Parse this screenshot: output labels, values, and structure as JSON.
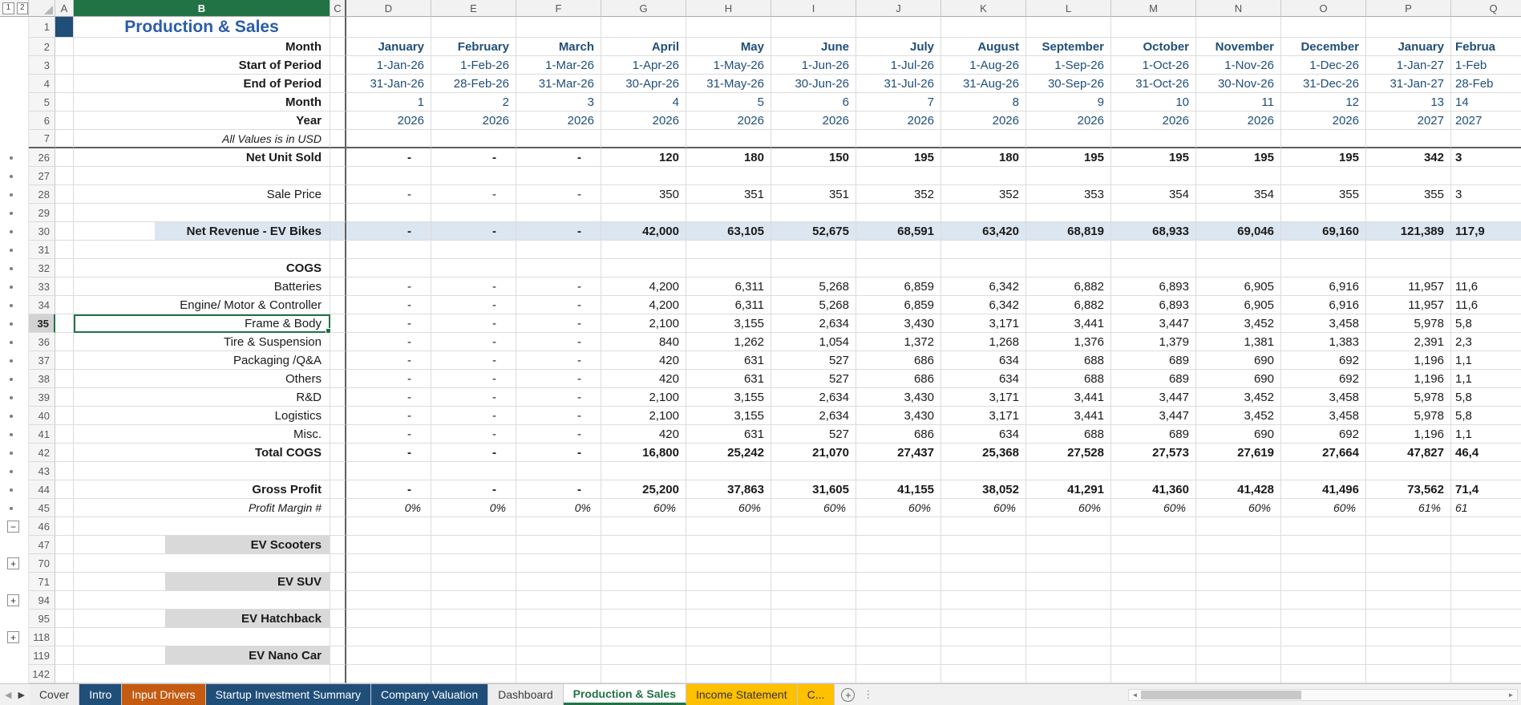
{
  "sheet": {
    "name": "Production & Sales",
    "outline_levels": [
      "1",
      "2"
    ],
    "outline_marks": {
      "collapse": "−",
      "expand": "+"
    },
    "columns": [
      "A",
      "B",
      "C",
      "D",
      "E",
      "F",
      "G",
      "H",
      "I",
      "J",
      "K",
      "L",
      "M",
      "N",
      "O",
      "P",
      "Q"
    ],
    "selection": {
      "cell": "B35",
      "column": "B",
      "row": 35
    },
    "rows": [
      {
        "n": 1,
        "type": "title",
        "label": "Production & Sales"
      },
      {
        "n": 2,
        "type": "months",
        "label": "Month",
        "values": [
          "January",
          "February",
          "March",
          "April",
          "May",
          "June",
          "July",
          "August",
          "September",
          "October",
          "November",
          "December",
          "January",
          "Februa"
        ]
      },
      {
        "n": 3,
        "type": "hdr",
        "label": "Start of Period",
        "values": [
          "1-Jan-26",
          "1-Feb-26",
          "1-Mar-26",
          "1-Apr-26",
          "1-May-26",
          "1-Jun-26",
          "1-Jul-26",
          "1-Aug-26",
          "1-Sep-26",
          "1-Oct-26",
          "1-Nov-26",
          "1-Dec-26",
          "1-Jan-27",
          "1-Feb"
        ]
      },
      {
        "n": 4,
        "type": "hdr",
        "label": "End of Period",
        "values": [
          "31-Jan-26",
          "28-Feb-26",
          "31-Mar-26",
          "30-Apr-26",
          "31-May-26",
          "30-Jun-26",
          "31-Jul-26",
          "31-Aug-26",
          "30-Sep-26",
          "31-Oct-26",
          "30-Nov-26",
          "31-Dec-26",
          "31-Jan-27",
          "28-Feb"
        ]
      },
      {
        "n": 5,
        "type": "hdr",
        "label": "Month",
        "values": [
          "1",
          "2",
          "3",
          "4",
          "5",
          "6",
          "7",
          "8",
          "9",
          "10",
          "11",
          "12",
          "13",
          "14"
        ]
      },
      {
        "n": 6,
        "type": "hdr",
        "label": "Year",
        "values": [
          "2026",
          "2026",
          "2026",
          "2026",
          "2026",
          "2026",
          "2026",
          "2026",
          "2026",
          "2026",
          "2026",
          "2026",
          "2027",
          "2027"
        ]
      },
      {
        "n": 7,
        "type": "note",
        "label": "All Values is in USD",
        "divider": true
      },
      {
        "n": 26,
        "type": "bold",
        "gutter": "dot",
        "label": "Net Unit Sold",
        "values": [
          "-",
          "-",
          "-",
          "120",
          "180",
          "150",
          "195",
          "180",
          "195",
          "195",
          "195",
          "195",
          "342",
          "3"
        ]
      },
      {
        "n": 27,
        "type": "blank",
        "gutter": "dot"
      },
      {
        "n": 28,
        "type": "plain",
        "gutter": "dot",
        "label": "Sale Price",
        "values": [
          "-",
          "-",
          "-",
          "350",
          "351",
          "351",
          "352",
          "352",
          "353",
          "354",
          "354",
          "355",
          "355",
          "3"
        ]
      },
      {
        "n": 29,
        "type": "blank",
        "gutter": "dot"
      },
      {
        "n": 30,
        "type": "highlight",
        "gutter": "dot",
        "label": "Net Revenue - EV Bikes",
        "values": [
          "-",
          "-",
          "-",
          "42,000",
          "63,105",
          "52,675",
          "68,591",
          "63,420",
          "68,819",
          "68,933",
          "69,046",
          "69,160",
          "121,389",
          "117,9"
        ]
      },
      {
        "n": 31,
        "type": "blank",
        "gutter": "dot"
      },
      {
        "n": 32,
        "type": "labelbold",
        "gutter": "dot",
        "label": "COGS"
      },
      {
        "n": 33,
        "type": "plain",
        "gutter": "dot",
        "label": "Batteries",
        "values": [
          "-",
          "-",
          "-",
          "4,200",
          "6,311",
          "5,268",
          "6,859",
          "6,342",
          "6,882",
          "6,893",
          "6,905",
          "6,916",
          "11,957",
          "11,6"
        ]
      },
      {
        "n": 34,
        "type": "plain",
        "gutter": "dot",
        "label": "Engine/ Motor & Controller",
        "values": [
          "-",
          "-",
          "-",
          "4,200",
          "6,311",
          "5,268",
          "6,859",
          "6,342",
          "6,882",
          "6,893",
          "6,905",
          "6,916",
          "11,957",
          "11,6"
        ]
      },
      {
        "n": 35,
        "type": "plain",
        "gutter": "dot",
        "label": "Frame & Body",
        "selected": true,
        "values": [
          "-",
          "-",
          "-",
          "2,100",
          "3,155",
          "2,634",
          "3,430",
          "3,171",
          "3,441",
          "3,447",
          "3,452",
          "3,458",
          "5,978",
          "5,8"
        ]
      },
      {
        "n": 36,
        "type": "plain",
        "gutter": "dot",
        "label": "Tire & Suspension",
        "values": [
          "-",
          "-",
          "-",
          "840",
          "1,262",
          "1,054",
          "1,372",
          "1,268",
          "1,376",
          "1,379",
          "1,381",
          "1,383",
          "2,391",
          "2,3"
        ]
      },
      {
        "n": 37,
        "type": "plain",
        "gutter": "dot",
        "label": "Packaging /Q&A",
        "values": [
          "-",
          "-",
          "-",
          "420",
          "631",
          "527",
          "686",
          "634",
          "688",
          "689",
          "690",
          "692",
          "1,196",
          "1,1"
        ]
      },
      {
        "n": 38,
        "type": "plain",
        "gutter": "dot",
        "label": "Others",
        "values": [
          "-",
          "-",
          "-",
          "420",
          "631",
          "527",
          "686",
          "634",
          "688",
          "689",
          "690",
          "692",
          "1,196",
          "1,1"
        ]
      },
      {
        "n": 39,
        "type": "plain",
        "gutter": "dot",
        "label": "R&D",
        "values": [
          "-",
          "-",
          "-",
          "2,100",
          "3,155",
          "2,634",
          "3,430",
          "3,171",
          "3,441",
          "3,447",
          "3,452",
          "3,458",
          "5,978",
          "5,8"
        ]
      },
      {
        "n": 40,
        "type": "plain",
        "gutter": "dot",
        "label": "Logistics",
        "values": [
          "-",
          "-",
          "-",
          "2,100",
          "3,155",
          "2,634",
          "3,430",
          "3,171",
          "3,441",
          "3,447",
          "3,452",
          "3,458",
          "5,978",
          "5,8"
        ]
      },
      {
        "n": 41,
        "type": "plain",
        "gutter": "dot",
        "label": "Misc.",
        "values": [
          "-",
          "-",
          "-",
          "420",
          "631",
          "527",
          "686",
          "634",
          "688",
          "689",
          "690",
          "692",
          "1,196",
          "1,1"
        ]
      },
      {
        "n": 42,
        "type": "bold",
        "gutter": "dot",
        "label": "Total COGS",
        "values": [
          "-",
          "-",
          "-",
          "16,800",
          "25,242",
          "21,070",
          "27,437",
          "25,368",
          "27,528",
          "27,573",
          "27,619",
          "27,664",
          "47,827",
          "46,4"
        ]
      },
      {
        "n": 43,
        "type": "blank",
        "gutter": "dot"
      },
      {
        "n": 44,
        "type": "bold",
        "gutter": "dot",
        "label": "Gross Profit",
        "values": [
          "-",
          "-",
          "-",
          "25,200",
          "37,863",
          "31,605",
          "41,155",
          "38,052",
          "41,291",
          "41,360",
          "41,428",
          "41,496",
          "73,562",
          "71,4"
        ]
      },
      {
        "n": 45,
        "type": "pct",
        "gutter": "dot",
        "label": "Profit Margin #",
        "values": [
          "0%",
          "0%",
          "0%",
          "60%",
          "60%",
          "60%",
          "60%",
          "60%",
          "60%",
          "60%",
          "60%",
          "60%",
          "61%",
          "61"
        ]
      },
      {
        "n": 46,
        "type": "blank",
        "gutter": "minus"
      },
      {
        "n": 47,
        "type": "section",
        "label": "EV Scooters"
      },
      {
        "n": 70,
        "type": "blank",
        "gutter": "plus"
      },
      {
        "n": 71,
        "type": "section",
        "label": "EV SUV"
      },
      {
        "n": 94,
        "type": "blank",
        "gutter": "plus"
      },
      {
        "n": 95,
        "type": "section",
        "label": "EV Hatchback"
      },
      {
        "n": 118,
        "type": "blank",
        "gutter": "plus"
      },
      {
        "n": 119,
        "type": "section",
        "label": "EV Nano Car"
      },
      {
        "n": 142,
        "type": "blank"
      }
    ]
  },
  "tab_bar": {
    "icons": {
      "prev": "◀",
      "next": "▶",
      "new_sheet": "+",
      "more": "⋮",
      "scroll_left": "◄",
      "scroll_right": "►"
    },
    "tabs": [
      {
        "label": "Cover",
        "bg": "#EDEDED",
        "fg": "#3b3b3b",
        "active": false
      },
      {
        "label": "Intro",
        "bg": "#1F4E79",
        "fg": "#FFFFFF",
        "active": false
      },
      {
        "label": "Input Drivers",
        "bg": "#C55A11",
        "fg": "#FFFFFF",
        "active": false
      },
      {
        "label": "Startup Investment Summary",
        "bg": "#1F4E79",
        "fg": "#FFFFFF",
        "active": false
      },
      {
        "label": "Company Valuation",
        "bg": "#1F4E79",
        "fg": "#FFFFFF",
        "active": false
      },
      {
        "label": "Dashboard",
        "bg": "#EDEDED",
        "fg": "#3b3b3b",
        "active": false
      },
      {
        "label": "Production & Sales",
        "bg": "#FFFFFF",
        "fg": "#217346",
        "active": true
      },
      {
        "label": "Income Statement",
        "bg": "#FFC000",
        "fg": "#333333",
        "active": false
      },
      {
        "label": "C...",
        "bg": "#FFC000",
        "fg": "#333333",
        "active": false
      }
    ]
  },
  "colors": {
    "header_navy": "#1F4E79",
    "title_blue": "#2A5DA8",
    "revenue_band_blue": "#DCE6F1",
    "section_gray": "#D9D9D9",
    "selection_green": "#217346",
    "tab_navy": "#1F4E79",
    "tab_orange": "#C55A11",
    "tab_gold": "#FFC000"
  }
}
